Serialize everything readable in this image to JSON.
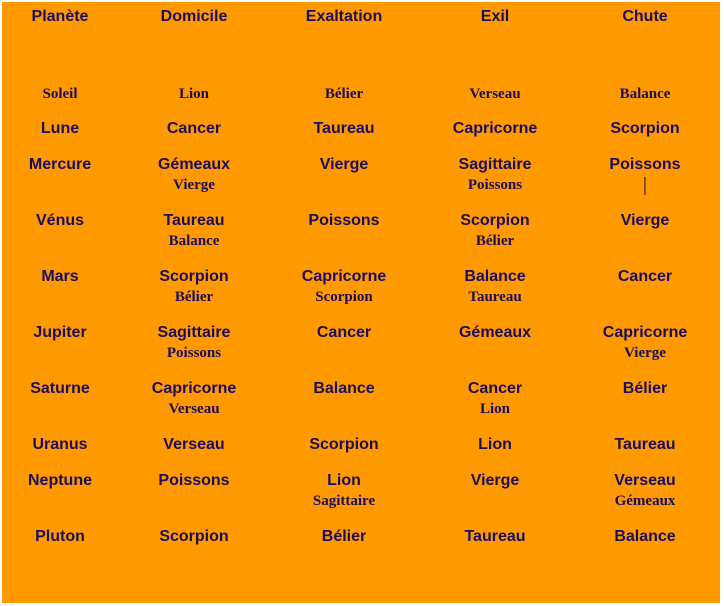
{
  "colors": {
    "background": "#ff9900",
    "text": "#1c0d5e"
  },
  "headers": [
    "Planète",
    "Domicile",
    "Exaltation",
    "Exil",
    "Chute"
  ],
  "rows": [
    {
      "planet": "Soleil",
      "style": "serif",
      "domicile": "Lion",
      "domicile_sub": null,
      "exaltation": "Bélier",
      "exaltation_sub": null,
      "exil": "Verseau",
      "exil_sub": null,
      "chute": "Balance",
      "chute_sub": null
    },
    {
      "planet": "Lune",
      "style": "sans",
      "domicile": "Cancer",
      "domicile_sub": null,
      "exaltation": "Taureau",
      "exaltation_sub": null,
      "exil": "Capricorne",
      "exil_sub": null,
      "chute": "Scorpion",
      "chute_sub": null
    },
    {
      "planet": "Mercure",
      "style": "sans",
      "domicile": "Gémeaux",
      "domicile_sub": "Vierge",
      "exaltation": "Vierge",
      "exaltation_sub": null,
      "exil": "Sagittaire",
      "exil_sub": "Poissons",
      "chute": "Poissons",
      "chute_sub": "|"
    },
    {
      "planet": "Vénus",
      "style": "sans",
      "domicile": "Taureau",
      "domicile_sub": "Balance",
      "exaltation": "Poissons",
      "exaltation_sub": null,
      "exil": "Scorpion",
      "exil_sub": "Bélier",
      "chute": "Vierge",
      "chute_sub": null
    },
    {
      "planet": "Mars",
      "style": "sans",
      "domicile": "Scorpion",
      "domicile_sub": "Bélier",
      "exaltation": "Capricorne",
      "exaltation_sub": "Scorpion",
      "exil": "Balance",
      "exil_sub": "Taureau",
      "chute": "Cancer",
      "chute_sub": null
    },
    {
      "planet": "Jupiter",
      "style": "sans",
      "domicile": "Sagittaire",
      "domicile_sub": "Poissons",
      "exaltation": "Cancer",
      "exaltation_sub": null,
      "exil": "Gémeaux",
      "exil_sub": null,
      "chute": "Capricorne",
      "chute_sub": "Vierge"
    },
    {
      "planet": "Saturne",
      "style": "sans",
      "domicile": "Capricorne",
      "domicile_sub": "Verseau",
      "exaltation": "Balance",
      "exaltation_sub": null,
      "exil": "Cancer",
      "exil_sub": "Lion",
      "chute": "Bélier",
      "chute_sub": null
    },
    {
      "planet": "Uranus",
      "style": "sans",
      "domicile": "Verseau",
      "domicile_sub": null,
      "exaltation": "Scorpion",
      "exaltation_sub": null,
      "exil": "Lion",
      "exil_sub": null,
      "chute": "Taureau",
      "chute_sub": null
    },
    {
      "planet": "Neptune",
      "style": "sans",
      "domicile": "Poissons",
      "domicile_sub": null,
      "exaltation": "Lion",
      "exaltation_sub": "Sagittaire",
      "exil": "Vierge",
      "exil_sub": null,
      "chute": "Verseau",
      "chute_sub": "Gémeaux"
    },
    {
      "planet": "Pluton",
      "style": "sans",
      "domicile": "Scorpion",
      "domicile_sub": null,
      "exaltation": "Bélier",
      "exaltation_sub": null,
      "exil": "Taureau",
      "exil_sub": null,
      "chute": "Balance",
      "chute_sub": null
    }
  ]
}
